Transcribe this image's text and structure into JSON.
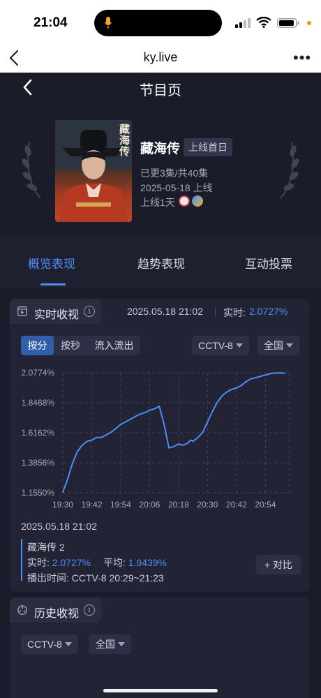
{
  "status_bar": {
    "time": "21:04"
  },
  "browser": {
    "title": "ky.live",
    "more": "•••"
  },
  "page": {
    "title": "节目页"
  },
  "show": {
    "poster_text": "藏海传",
    "name": "藏海传",
    "badge": "上线首日",
    "episodes": "已更3集/共40集",
    "release": "2025-05-18 上线",
    "online_days": "上线1天"
  },
  "tabs": [
    {
      "label": "概览表现"
    },
    {
      "label": "趋势表现"
    },
    {
      "label": "互动投票"
    }
  ],
  "realtime": {
    "title": "实时收视",
    "info": "i",
    "timestamp": "2025.05.18 21:02",
    "current_label": "实时:",
    "current_value": "2.0727%",
    "modes": [
      "按分",
      "按秒",
      "流入流出"
    ],
    "channel": "CCTV-8",
    "region": "全国",
    "tooltip": {
      "time": "2025.05.18 21:02",
      "program": "藏海传 2",
      "realtime_label": "实时:",
      "realtime_value": "2.0727%",
      "average_label": "平均:",
      "average_value": "1.9439%",
      "broadcast": "播出时间:  CCTV-8 20:29~21:23"
    },
    "compare_label": "+ 对比"
  },
  "history": {
    "title": "历史收视",
    "info": "i",
    "channel": "CCTV-8",
    "region": "全国"
  },
  "chart_data": {
    "type": "line",
    "y_ticks": [
      "2.0774%",
      "1.8468%",
      "1.6162%",
      "1.3856%",
      "1.1550%"
    ],
    "x_ticks": [
      "19:30",
      "19:42",
      "19:54",
      "20:06",
      "20:18",
      "20:30",
      "20:42",
      "20:54"
    ],
    "ylim": [
      1.155,
      2.0774
    ],
    "xlim_minutes": [
      0,
      94
    ],
    "grid": true,
    "color": "#4c8df6",
    "series": [
      {
        "x": [
          0,
          2,
          4,
          6,
          8,
          10,
          12,
          14,
          16,
          18,
          20,
          22,
          24,
          26,
          28,
          30,
          32,
          34,
          36,
          38,
          40,
          42,
          44,
          46,
          48,
          50,
          52,
          53,
          54,
          56,
          58,
          60,
          62,
          64,
          66,
          68,
          70,
          72,
          74,
          76,
          78,
          80,
          82,
          84,
          86,
          88,
          90,
          92
        ],
        "y": [
          1.16,
          1.26,
          1.38,
          1.47,
          1.52,
          1.55,
          1.56,
          1.58,
          1.58,
          1.6,
          1.62,
          1.65,
          1.68,
          1.7,
          1.72,
          1.74,
          1.76,
          1.77,
          1.79,
          1.8,
          1.82,
          1.68,
          1.5,
          1.51,
          1.53,
          1.52,
          1.54,
          1.56,
          1.55,
          1.58,
          1.62,
          1.7,
          1.78,
          1.85,
          1.9,
          1.93,
          1.95,
          1.96,
          1.98,
          2.01,
          2.03,
          2.04,
          2.05,
          2.06,
          2.07,
          2.075,
          2.077,
          2.073
        ]
      }
    ]
  },
  "colors": {
    "accent": "#4c8df6",
    "background": "#1b1c2a",
    "card": "#222435"
  }
}
